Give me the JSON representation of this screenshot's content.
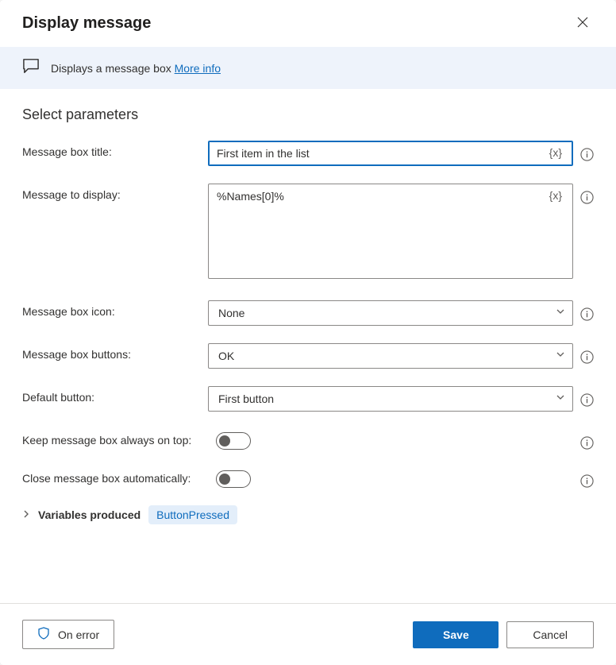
{
  "header": {
    "title": "Display message"
  },
  "banner": {
    "text": "Displays a message box ",
    "link": "More info"
  },
  "section_title": "Select parameters",
  "fields": {
    "title": {
      "label": "Message box title:",
      "value": "First item in the list",
      "var_btn": "{x}"
    },
    "message": {
      "label": "Message to display:",
      "value": "%Names[0]%",
      "var_btn": "{x}"
    },
    "icon": {
      "label": "Message box icon:",
      "value": "None"
    },
    "buttons": {
      "label": "Message box buttons:",
      "value": "OK"
    },
    "default_btn": {
      "label": "Default button:",
      "value": "First button"
    },
    "on_top": {
      "label": "Keep message box always on top:"
    },
    "auto_close": {
      "label": "Close message box automatically:"
    }
  },
  "variables": {
    "label": "Variables produced",
    "chip": "ButtonPressed"
  },
  "footer": {
    "on_error": "On error",
    "save": "Save",
    "cancel": "Cancel"
  }
}
